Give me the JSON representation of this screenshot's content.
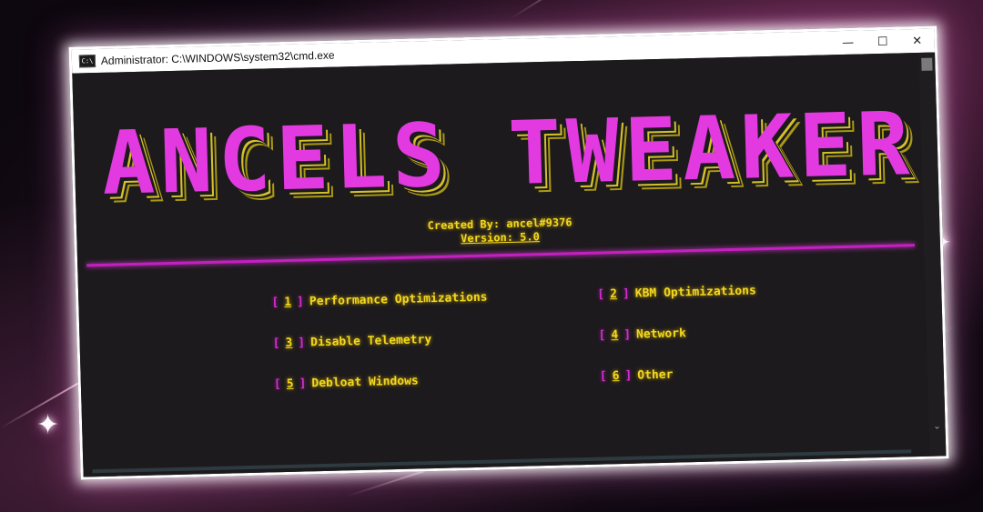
{
  "window": {
    "title": "Administrator: C:\\WINDOWS\\system32\\cmd.exe",
    "icon": "cmd-icon",
    "controls": {
      "minimize": "—",
      "maximize": "☐",
      "close": "✕"
    }
  },
  "banner": {
    "logo": "ANCELS TWEAKER",
    "created_by": "Created By: ancel#9376",
    "version": "Version: 5.0"
  },
  "menu": {
    "bracket_open": "[",
    "bracket_close": "]",
    "items": [
      {
        "num": "1",
        "label": "Performance Optimizations"
      },
      {
        "num": "2",
        "label": "KBM Optimizations"
      },
      {
        "num": "3",
        "label": "Disable Telemetry"
      },
      {
        "num": "4",
        "label": "Network"
      },
      {
        "num": "5",
        "label": "Debloat Windows"
      },
      {
        "num": "6",
        "label": "Other"
      }
    ]
  },
  "colors": {
    "logo": "#e23ae0",
    "logo_shadow": "#d4c12a",
    "text": "#f2d81e",
    "bracket": "#d42fd0",
    "divider": "#c51fc2",
    "console_bg": "#1c1a1c"
  },
  "scrollbar": {
    "down_arrow": "⌄"
  }
}
